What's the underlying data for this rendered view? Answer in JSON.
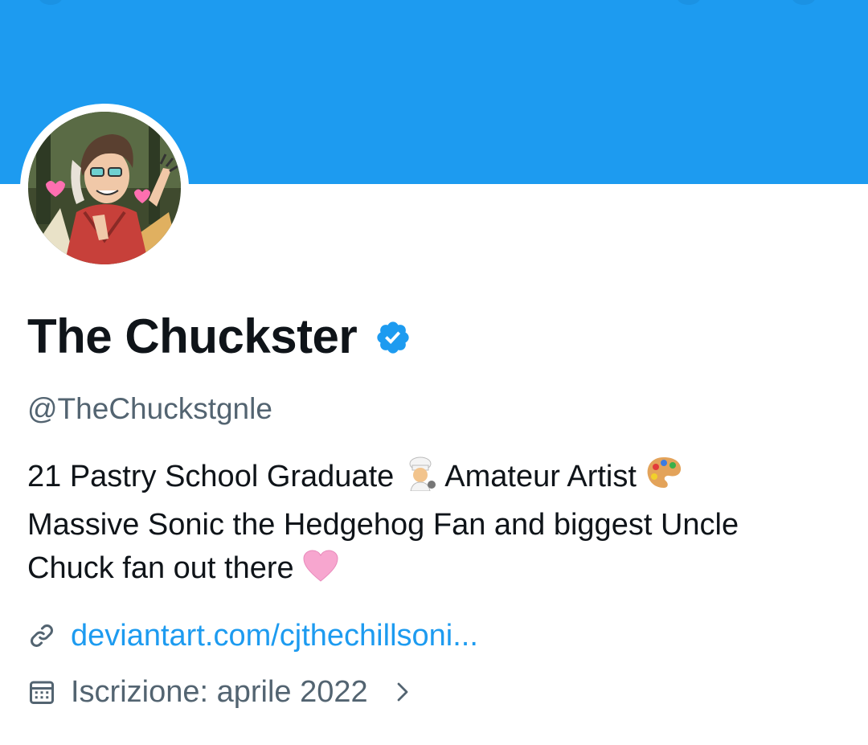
{
  "profile": {
    "display_name": "The Chuckster",
    "handle": "@TheChuckstgnle",
    "verified": true,
    "bio": {
      "line1_a": "21  Pastry School Graduate ",
      "emoji_chef": "cook-emoji",
      "line1_b": " Amateur Artist ",
      "emoji_palette": "artist-palette-emoji",
      "line2": "Massive Sonic the Hedgehog Fan and biggest Uncle",
      "line3": "Chuck fan out there ",
      "emoji_heart": "pink-heart-emoji"
    },
    "website": "deviantart.com/cjthechillsoni...",
    "joined": "Iscrizione: aprile 2022"
  },
  "icons": {
    "verified": "verified-badge-icon",
    "link": "link-icon",
    "calendar": "calendar-icon",
    "chevron": "chevron-right-icon"
  },
  "colors": {
    "banner": "#1d9bf0",
    "accent": "#1d9bf0",
    "text_primary": "#0f1419",
    "text_secondary": "#536471"
  }
}
